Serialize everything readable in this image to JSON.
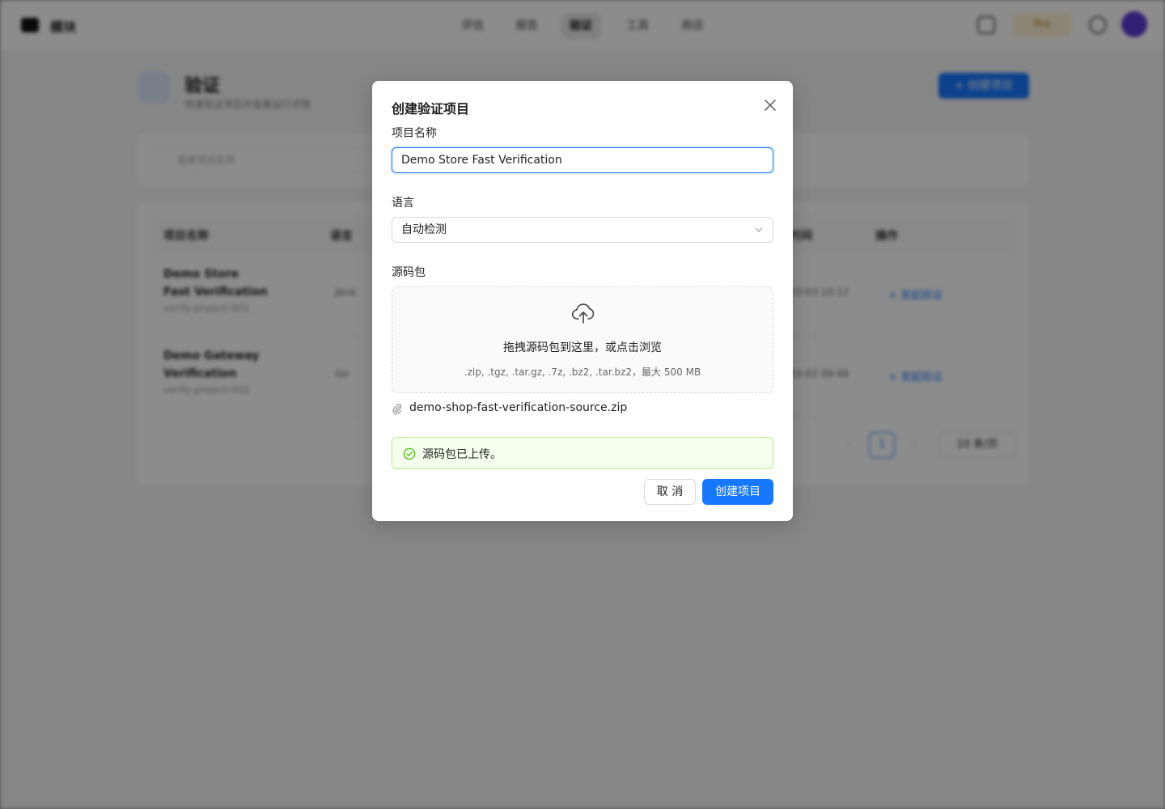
{
  "app": {
    "brand": "模块",
    "nav": [
      "评估",
      "报告",
      "验证",
      "工具",
      "商店"
    ],
    "active_nav": "验证",
    "plan_badge": "Pro",
    "page_title": "验证",
    "page_subtitle": "快速验证项目并查看运行详情",
    "new_button": "+ 创建项目",
    "search_placeholder": "搜索项目名称",
    "table": {
      "headers": [
        "项目名称",
        "语言",
        "时间",
        "操作"
      ],
      "rows": [
        {
          "name": "Demo Store Fast Verification",
          "sub": "verify-project-001",
          "lang": "Java",
          "time": "03-03 10:12",
          "action": "+ 发起验证"
        },
        {
          "name": "Demo Gateway Verification",
          "sub": "verify-project-002",
          "lang": "Go",
          "time": "03-03 09:48",
          "action": "+ 发起验证"
        }
      ],
      "page": "1",
      "page_size": "10 条/页"
    }
  },
  "modal": {
    "title": "创建验证项目",
    "name_label": "项目名称",
    "name_value": "Demo Store Fast Verification",
    "lang_label": "语言",
    "lang_value": "自动检测",
    "source_label": "源码包",
    "drop_text": "拖拽源码包到这里，或点击浏览",
    "drop_hint": ".zip, .tgz, .tar.gz, .7z, .bz2, .tar.bz2，最大 500 MB",
    "file_name": "demo-shop-fast-verification-source.zip",
    "alert_text": "源码包已上传。",
    "cancel_label": "取 消",
    "create_label": "创建项目"
  }
}
